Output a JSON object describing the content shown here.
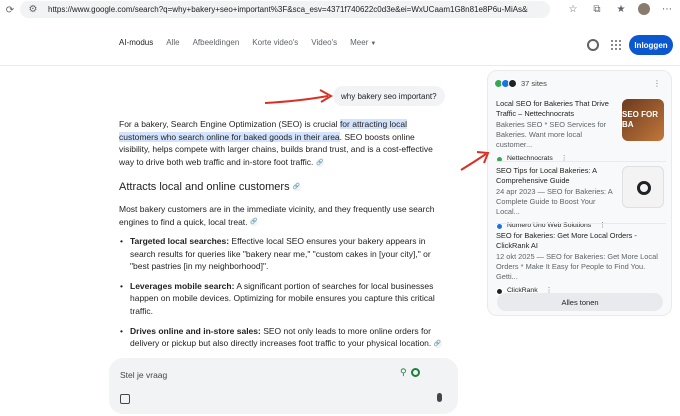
{
  "browser": {
    "url": "https://www.google.com/search?q=why+bakery+seo+important%3F&sca_esv=4371f740622c0d3e&ei=WxUCaam1G8n81e8P6u-MiAs&iflsig=AOw8s4IA..."
  },
  "header": {
    "tabs": [
      {
        "label": "AI-modus"
      },
      {
        "label": "Alle"
      },
      {
        "label": "Afbeeldingen"
      },
      {
        "label": "Korte video's"
      },
      {
        "label": "Video's"
      },
      {
        "label": "Meer"
      }
    ],
    "login_label": "Inloggen"
  },
  "query": "why bakery seo important?",
  "answer": {
    "p1_a": "For a bakery, Search Engine Optimization (SEO) is crucial ",
    "p1_hl": "for attracting local customers who search online for baked goods in their area",
    "p1_b": ". SEO boosts online visibility, helps compete with larger chains, builds brand trust, and is a cost-effective way to drive both web traffic and in-store foot traffic.",
    "h2": "Attracts local and online customers",
    "p2": "Most bakery customers are in the immediate vicinity, and they frequently use search engines to find a quick, local treat.",
    "bullets": [
      {
        "title": "Targeted local searches:",
        "text": " Effective local SEO ensures your bakery appears in search results for queries like \"bakery near me,\" \"custom cakes in [your city],\" or \"best pastries [in my neighborhood]\"."
      },
      {
        "title": "Leverages mobile search:",
        "text": " A significant portion of searches for local businesses happen on mobile devices. Optimizing for mobile ensures you capture this critical traffic."
      },
      {
        "title": "Drives online and in-store sales:",
        "text": " SEO not only leads to more online orders for delivery or pickup but also directly increases foot traffic to your physical location."
      }
    ]
  },
  "ask": {
    "placeholder": "Stel je vraag"
  },
  "sidebar": {
    "sites_label": "37 sites",
    "cards": [
      {
        "title": "Local SEO for Bakeries That Drive Traffic – Nettechnocrats",
        "snippet": "Bakeries SEO * SEO Services for Bakeries. Want more local customer...",
        "source": "Nettechnocrats",
        "thumb_text": "SEO FOR BA"
      },
      {
        "title": "SEO Tips for Local Bakeries: A Comprehensive Guide",
        "snippet": "24 apr 2023 — SEO for Bakeries: A Complete Guide to Boost Your Local...",
        "source": "Numero Uno Web Solutions"
      },
      {
        "title": "SEO for Bakeries: Get More Local Orders - ClickRank AI",
        "snippet": "12 okt 2025 — SEO for Bakeries: Get More Local Orders * Make It Easy for People to Find You. Getti...",
        "source": "ClickRank"
      }
    ],
    "show_all_label": "Alles tonen"
  },
  "colors": {
    "accent": "#0b57d0",
    "highlight": "#d3e3fd",
    "arrow": "#d93025"
  }
}
